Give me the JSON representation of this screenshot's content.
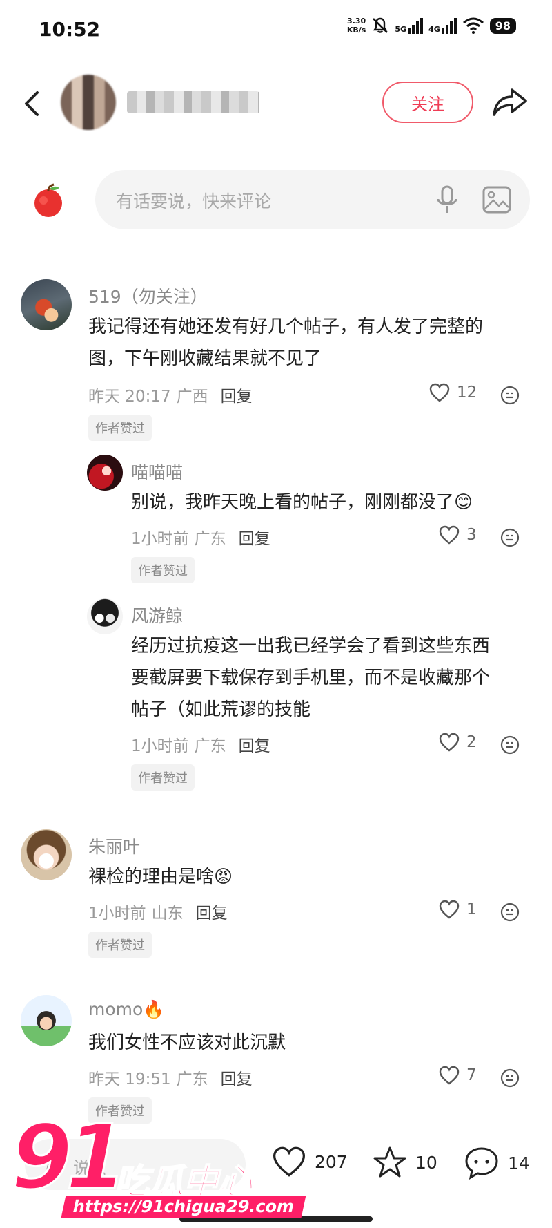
{
  "status": {
    "time": "10:52",
    "net_speed_value": "3.30",
    "net_speed_unit": "KB/s",
    "sig1": "5G",
    "sig2": "4G",
    "battery": "98"
  },
  "header": {
    "follow_label": "关注"
  },
  "compose": {
    "placeholder": "有话要说，快来评论"
  },
  "comments": [
    {
      "user": "519（勿关注）",
      "lines": [
        "我记得还有她还发有好几个帖子，有人发了完整的",
        "图，下午刚收藏结果就不见了"
      ],
      "time": "昨天 20:17",
      "location": "广西",
      "reply_label": "回复",
      "likes": "12",
      "badge": "作者赞过"
    },
    {
      "user": "喵喵喵",
      "lines": [
        "别说，我昨天晚上看的帖子，刚刚都没了😊"
      ],
      "time": "1小时前",
      "location": "广东",
      "reply_label": "回复",
      "likes": "3",
      "badge": "作者赞过"
    },
    {
      "user": "风游鲸",
      "lines": [
        "经历过抗疫这一出我已经学会了看到这些东西",
        "要截屏要下载保存到手机里，而不是收藏那个",
        "帖子（如此荒谬的技能"
      ],
      "time": "1小时前",
      "location": "广东",
      "reply_label": "回复",
      "likes": "2",
      "badge": "作者赞过"
    },
    {
      "user": "朱丽叶",
      "lines": [
        "裸检的理由是啥😡"
      ],
      "time": "1小时前",
      "location": "山东",
      "reply_label": "回复",
      "likes": "1",
      "badge": "作者赞过"
    },
    {
      "user": "momo🔥",
      "lines": [
        "我们女性不应该对此沉默"
      ],
      "time": "昨天 19:51",
      "location": "广东",
      "reply_label": "回复",
      "likes": "7",
      "badge": "作者赞过"
    }
  ],
  "bottom": {
    "input_text": "说点",
    "likes": "207",
    "stars": "10",
    "comments": "14"
  },
  "watermark": {
    "number": "91",
    "brand": "吃瓜中心",
    "url": "https://91chigua29.com"
  },
  "colors": {
    "accent": "#ef3c55",
    "watermark": "#ff1f67"
  }
}
